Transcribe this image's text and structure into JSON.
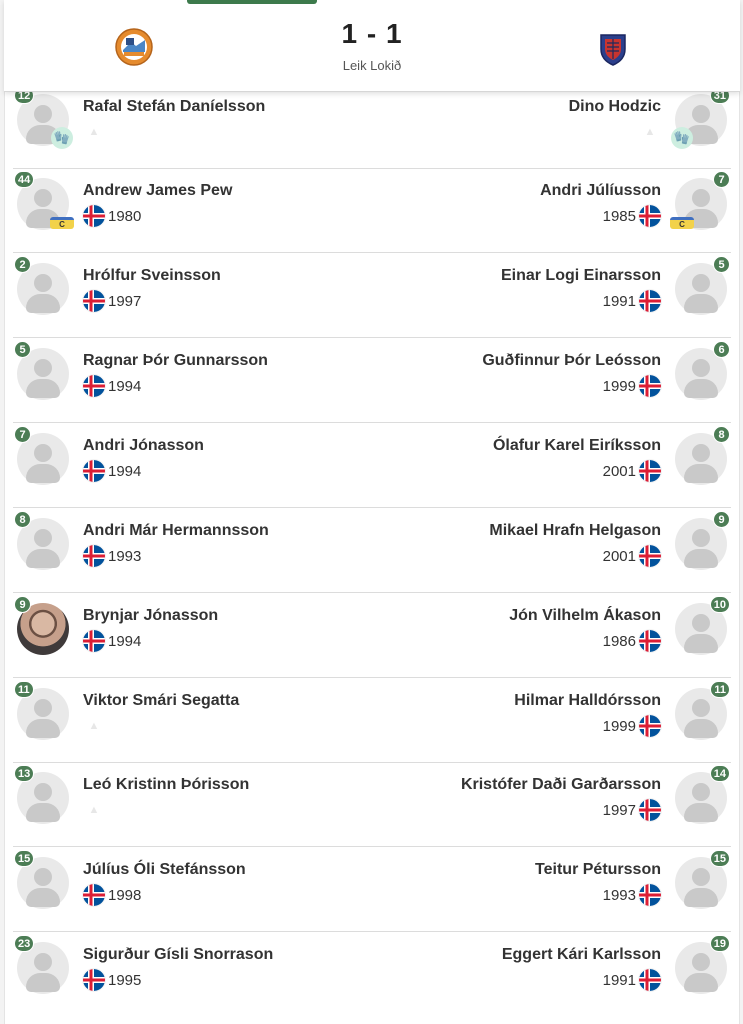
{
  "match": {
    "score": "1 - 1",
    "status": "Leik Lokið",
    "home_logo_icon": "home-team-crest-icon",
    "away_logo_icon": "away-team-crest-icon",
    "accent_color": "#4c7d55"
  },
  "rows": [
    {
      "home": {
        "number": "12",
        "name": "Rafal Stefán Daníelsson",
        "year": "",
        "badge": "goalkeeper-glove"
      },
      "away": {
        "number": "31",
        "name": "Dino Hodzic",
        "year": "",
        "badge": "goalkeeper-glove"
      }
    },
    {
      "home": {
        "number": "44",
        "name": "Andrew James Pew",
        "year": "1980",
        "badge": "captain"
      },
      "away": {
        "number": "7",
        "name": "Andri Júlíusson",
        "year": "1985",
        "badge": "captain"
      }
    },
    {
      "home": {
        "number": "2",
        "name": "Hrólfur Sveinsson",
        "year": "1997"
      },
      "away": {
        "number": "5",
        "name": "Einar Logi Einarsson",
        "year": "1991"
      }
    },
    {
      "home": {
        "number": "5",
        "name": "Ragnar Þór Gunnarsson",
        "year": "1994"
      },
      "away": {
        "number": "6",
        "name": "Guðfinnur Þór Leósson",
        "year": "1999"
      }
    },
    {
      "home": {
        "number": "7",
        "name": "Andri Jónasson",
        "year": "1994"
      },
      "away": {
        "number": "8",
        "name": "Ólafur Karel Eiríksson",
        "year": "2001"
      }
    },
    {
      "home": {
        "number": "8",
        "name": "Andri Már Hermannsson",
        "year": "1993"
      },
      "away": {
        "number": "9",
        "name": "Mikael Hrafn Helgason",
        "year": "2001"
      }
    },
    {
      "home": {
        "number": "9",
        "name": "Brynjar Jónasson",
        "year": "1994",
        "photo": true
      },
      "away": {
        "number": "10",
        "name": "Jón Vilhelm Ákason",
        "year": "1986"
      }
    },
    {
      "home": {
        "number": "11",
        "name": "Viktor Smári Segatta",
        "year": ""
      },
      "away": {
        "number": "11",
        "name": "Hilmar Halldórsson",
        "year": "1999"
      }
    },
    {
      "home": {
        "number": "13",
        "name": "Leó Kristinn Þórisson",
        "year": ""
      },
      "away": {
        "number": "14",
        "name": "Kristófer Daði Garðarsson",
        "year": "1997"
      }
    },
    {
      "home": {
        "number": "15",
        "name": "Júlíus Óli Stefánsson",
        "year": "1998"
      },
      "away": {
        "number": "15",
        "name": "Teitur Pétursson",
        "year": "1993"
      }
    },
    {
      "home": {
        "number": "23",
        "name": "Sigurður Gísli Snorrason",
        "year": "1995"
      },
      "away": {
        "number": "19",
        "name": "Eggert Kári Karlsson",
        "year": "1991"
      }
    }
  ]
}
